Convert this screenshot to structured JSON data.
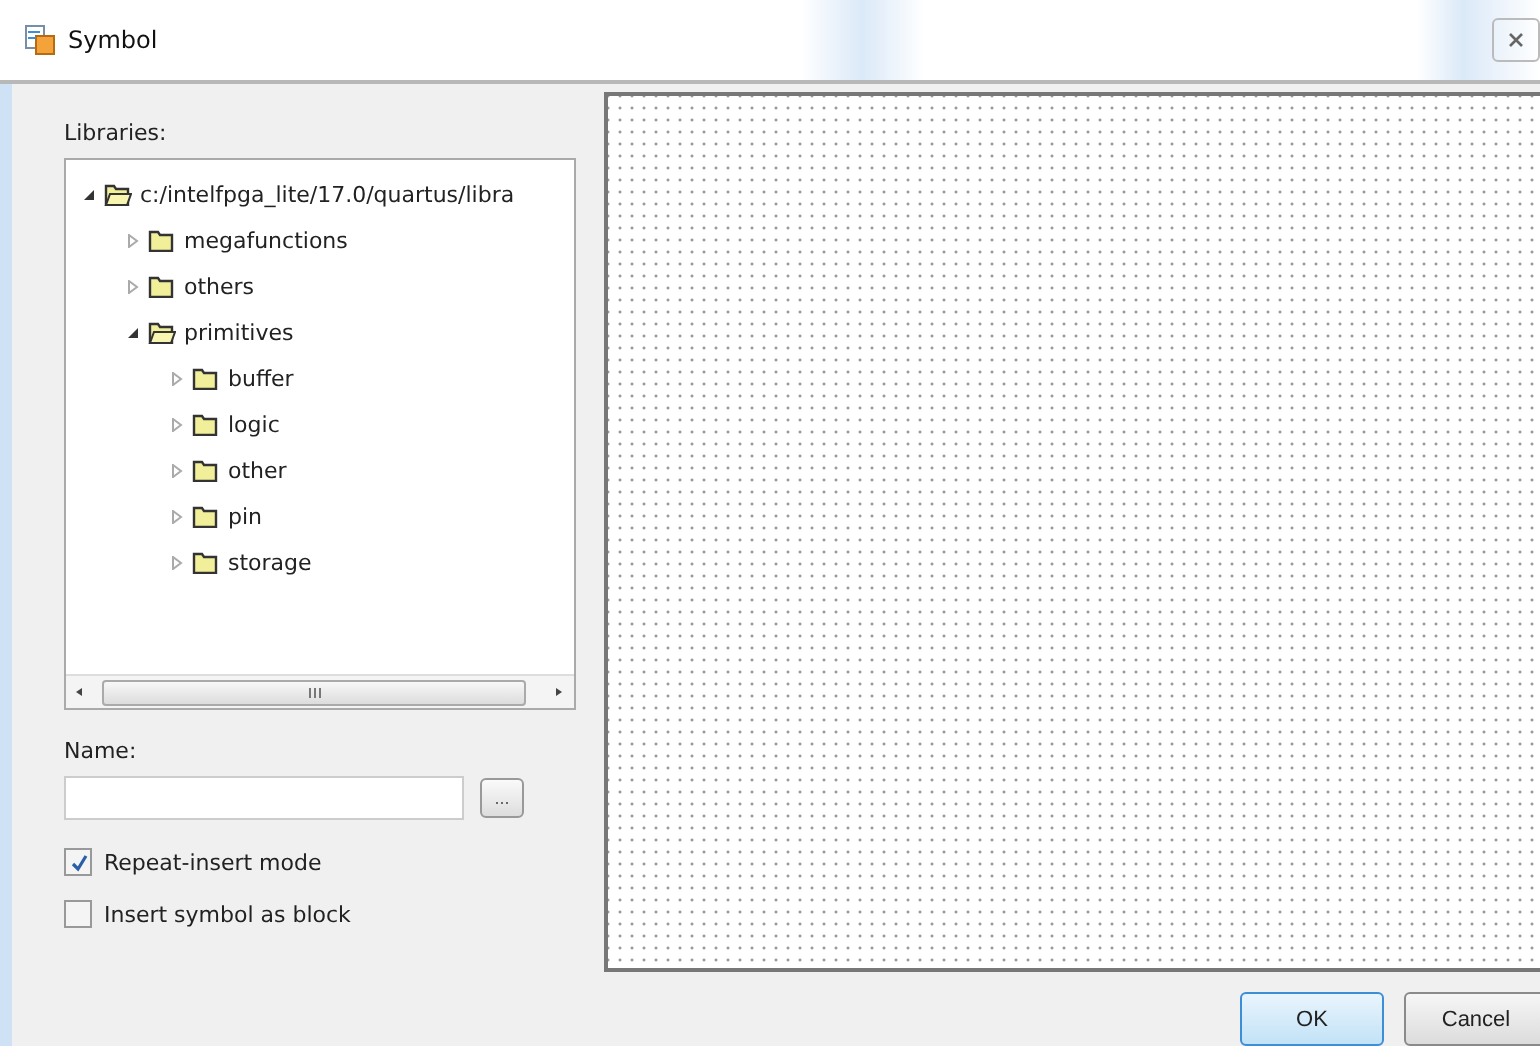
{
  "window": {
    "title": "Symbol"
  },
  "libraries": {
    "label": "Libraries:",
    "tree": [
      {
        "label": "c:/intelfpga_lite/17.0/quartus/libra",
        "expanded": true,
        "children": [
          {
            "label": "megafunctions",
            "expanded": false
          },
          {
            "label": "others",
            "expanded": false
          },
          {
            "label": "primitives",
            "expanded": true,
            "children": [
              {
                "label": "buffer",
                "expanded": false
              },
              {
                "label": "logic",
                "expanded": false
              },
              {
                "label": "other",
                "expanded": false
              },
              {
                "label": "pin",
                "expanded": false
              },
              {
                "label": "storage",
                "expanded": false
              }
            ]
          }
        ]
      }
    ]
  },
  "name": {
    "label": "Name:",
    "browse_button": "..."
  },
  "options": [
    {
      "label": "Repeat-insert mode",
      "checked": true
    },
    {
      "label": "Insert symbol as block",
      "checked": false
    }
  ],
  "buttons": [
    {
      "label": "OK",
      "default": true
    },
    {
      "label": "Cancel",
      "default": false
    }
  ]
}
